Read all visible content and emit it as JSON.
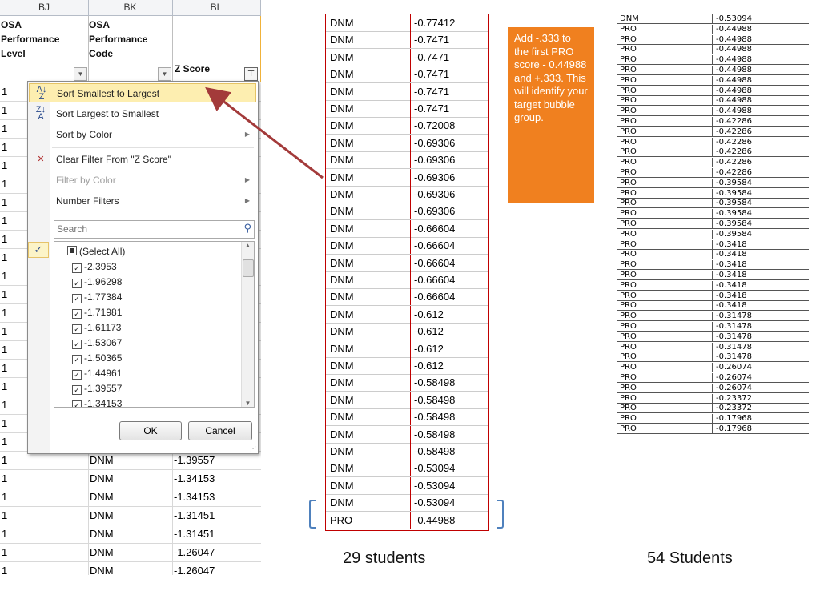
{
  "excel": {
    "columns": [
      "BJ",
      "BK",
      "BL"
    ],
    "headers": [
      {
        "lines": "OSA\nPerformance\nLevel"
      },
      {
        "lines": "OSA\nPerformance\nCode"
      },
      {
        "lines": "Z Score"
      }
    ],
    "rows_above": [
      "1",
      "1",
      "1",
      "1",
      "1",
      "1",
      "1",
      "1",
      "1",
      "1",
      "1",
      "1",
      "1",
      "1",
      "1",
      "1",
      "1",
      "1",
      "1",
      "1",
      "1"
    ],
    "rows": [
      {
        "a": "1",
        "b": "DNM",
        "c": "-1.39557"
      },
      {
        "a": "1",
        "b": "DNM",
        "c": "-1.34153"
      },
      {
        "a": "1",
        "b": "DNM",
        "c": "-1.34153"
      },
      {
        "a": "1",
        "b": "DNM",
        "c": "-1.31451"
      },
      {
        "a": "1",
        "b": "DNM",
        "c": "-1.31451"
      },
      {
        "a": "1",
        "b": "DNM",
        "c": "-1.26047"
      },
      {
        "a": "1",
        "b": "DNM",
        "c": "-1.26047"
      }
    ],
    "menu": {
      "sort_asc": "Sort Smallest to Largest",
      "sort_desc": "Sort Largest to Smallest",
      "sort_color": "Sort by Color",
      "clear_filter": "Clear Filter From \"Z Score\"",
      "filter_color": "Filter by Color",
      "number_filters": "Number Filters",
      "search_placeholder": "Search",
      "select_all": "(Select All)",
      "values": [
        "-2.3953",
        "-1.96298",
        "-1.77384",
        "-1.71981",
        "-1.61173",
        "-1.53067",
        "-1.50365",
        "-1.44961",
        "-1.39557",
        "-1.34153"
      ],
      "ok": "OK",
      "cancel": "Cancel"
    }
  },
  "middle_table": {
    "rows": [
      [
        "DNM",
        "-0.77412"
      ],
      [
        "DNM",
        "-0.7471"
      ],
      [
        "DNM",
        "-0.7471"
      ],
      [
        "DNM",
        "-0.7471"
      ],
      [
        "DNM",
        "-0.7471"
      ],
      [
        "DNM",
        "-0.7471"
      ],
      [
        "DNM",
        "-0.72008"
      ],
      [
        "DNM",
        "-0.69306"
      ],
      [
        "DNM",
        "-0.69306"
      ],
      [
        "DNM",
        "-0.69306"
      ],
      [
        "DNM",
        "-0.69306"
      ],
      [
        "DNM",
        "-0.69306"
      ],
      [
        "DNM",
        "-0.66604"
      ],
      [
        "DNM",
        "-0.66604"
      ],
      [
        "DNM",
        "-0.66604"
      ],
      [
        "DNM",
        "-0.66604"
      ],
      [
        "DNM",
        "-0.66604"
      ],
      [
        "DNM",
        "-0.612"
      ],
      [
        "DNM",
        "-0.612"
      ],
      [
        "DNM",
        "-0.612"
      ],
      [
        "DNM",
        "-0.612"
      ],
      [
        "DNM",
        "-0.58498"
      ],
      [
        "DNM",
        "-0.58498"
      ],
      [
        "DNM",
        "-0.58498"
      ],
      [
        "DNM",
        "-0.58498"
      ],
      [
        "DNM",
        "-0.58498"
      ],
      [
        "DNM",
        "-0.53094"
      ],
      [
        "DNM",
        "-0.53094"
      ],
      [
        "DNM",
        "-0.53094"
      ],
      [
        "PRO",
        "-0.44988"
      ]
    ],
    "caption": "29 students"
  },
  "callout": {
    "text": "Add -.333 to the first PRO score - 0.44988 and +.333. This will identify your target bubble group."
  },
  "right_table": {
    "rows": [
      [
        "DNM",
        "-0.53094"
      ],
      [
        "PRO",
        "-0.44988"
      ],
      [
        "PRO",
        "-0.44988"
      ],
      [
        "PRO",
        "-0.44988"
      ],
      [
        "PRO",
        "-0.44988"
      ],
      [
        "PRO",
        "-0.44988"
      ],
      [
        "PRO",
        "-0.44988"
      ],
      [
        "PRO",
        "-0.44988"
      ],
      [
        "PRO",
        "-0.44988"
      ],
      [
        "PRO",
        "-0.44988"
      ],
      [
        "PRO",
        "-0.42286"
      ],
      [
        "PRO",
        "-0.42286"
      ],
      [
        "PRO",
        "-0.42286"
      ],
      [
        "PRO",
        "-0.42286"
      ],
      [
        "PRO",
        "-0.42286"
      ],
      [
        "PRO",
        "-0.42286"
      ],
      [
        "PRO",
        "-0.39584"
      ],
      [
        "PRO",
        "-0.39584"
      ],
      [
        "PRO",
        "-0.39584"
      ],
      [
        "PRO",
        "-0.39584"
      ],
      [
        "PRO",
        "-0.39584"
      ],
      [
        "PRO",
        "-0.39584"
      ],
      [
        "PRO",
        "-0.3418"
      ],
      [
        "PRO",
        "-0.3418"
      ],
      [
        "PRO",
        "-0.3418"
      ],
      [
        "PRO",
        "-0.3418"
      ],
      [
        "PRO",
        "-0.3418"
      ],
      [
        "PRO",
        "-0.3418"
      ],
      [
        "PRO",
        "-0.3418"
      ],
      [
        "PRO",
        "-0.31478"
      ],
      [
        "PRO",
        "-0.31478"
      ],
      [
        "PRO",
        "-0.31478"
      ],
      [
        "PRO",
        "-0.31478"
      ],
      [
        "PRO",
        "-0.31478"
      ],
      [
        "PRO",
        "-0.26074"
      ],
      [
        "PRO",
        "-0.26074"
      ],
      [
        "PRO",
        "-0.26074"
      ],
      [
        "PRO",
        "-0.23372"
      ],
      [
        "PRO",
        "-0.23372"
      ],
      [
        "PRO",
        "-0.17968"
      ],
      [
        "PRO",
        "-0.17968"
      ]
    ],
    "caption": "54 Students"
  },
  "colors": {
    "callout": "#f0801f",
    "table_border": "#c00000",
    "bracket": "#4f81bd",
    "arrow": "#a33a3a"
  }
}
